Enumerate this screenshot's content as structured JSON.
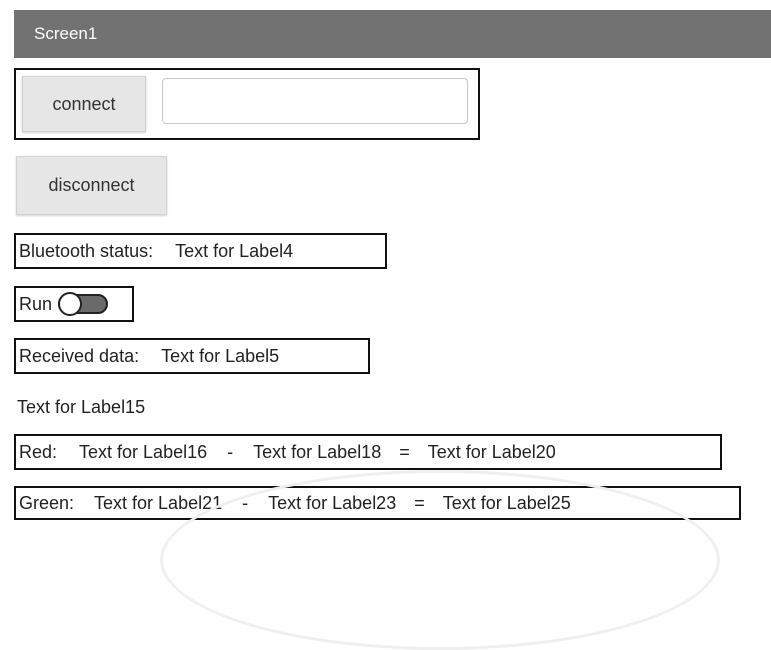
{
  "screen": {
    "title": "Screen1"
  },
  "connect_row": {
    "button_label": "connect",
    "input_value": "",
    "input_placeholder": ""
  },
  "disconnect_button": {
    "label": "disconnect"
  },
  "bluetooth_status": {
    "label": "Bluetooth status:",
    "value": "Text for Label4"
  },
  "run_switch": {
    "label": "Run",
    "on": false
  },
  "received_data": {
    "label": "Received data:",
    "value": "Text for Label5"
  },
  "label15": {
    "text": "Text for Label15"
  },
  "red_row": {
    "name": "Red:",
    "a": "Text for Label16",
    "minus": "-",
    "b": "Text for Label18",
    "equals": "=",
    "result": "Text for Label20"
  },
  "green_row": {
    "name": "Green:",
    "a": "Text for Label21",
    "minus": "-",
    "b": "Text for Label23",
    "equals": "=",
    "result": "Text for Label25"
  },
  "colors": {
    "titlebar_bg": "#727272",
    "button_bg": "#e6e6e6",
    "border": "#111111",
    "switch_track": "#6a6a6a"
  }
}
